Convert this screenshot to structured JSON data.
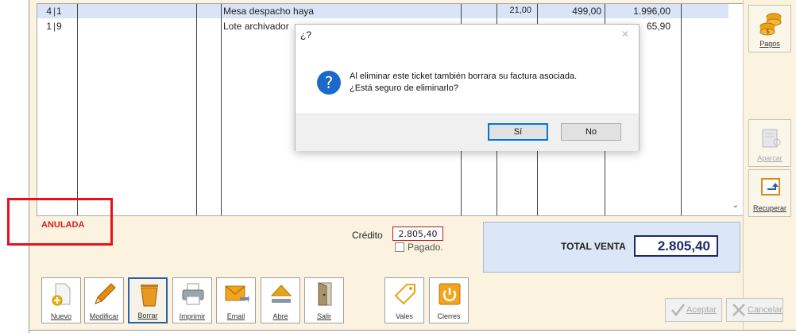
{
  "grid": {
    "rows": [
      {
        "qty": "4",
        "code": "1",
        "description": "Mesa despacho haya",
        "discount": "21,00",
        "price": "499,00",
        "total": "1.996,00"
      },
      {
        "qty": "1",
        "code": "9",
        "description": "Lote archivador",
        "discount": "",
        "price": "",
        "total": "65,90"
      }
    ]
  },
  "status": {
    "anulada": "ANULADA"
  },
  "credito": {
    "label": "Crédito",
    "value": "2.805,40",
    "pagado_label": "Pagado."
  },
  "total": {
    "label": "TOTAL VENTA",
    "value": "2.805,40"
  },
  "toolbar": {
    "nuevo": "Nuevo",
    "modificar": "Modificar",
    "borrar": "Borrar",
    "imprimir": "Imprimir",
    "email": "Email",
    "abre": "Abre",
    "salir": "Salir",
    "vales": "Vales",
    "cierres": "Cierres"
  },
  "right_panel": {
    "pagos": "Pagos",
    "aparcar": "Aparcar",
    "recuperar": "Recuperar"
  },
  "actions": {
    "aceptar": "Aceptar",
    "cancelar": "Cancelar"
  },
  "dialog": {
    "title": "¿?",
    "message_line1": "Al eliminar este ticket también borrara su factura asociada.",
    "message_line2": "¿Está seguro de eliminarlo?",
    "yes": "Sí",
    "no": "No"
  },
  "colors": {
    "accent_red": "#e8101a",
    "panel_bg": "#fbf3e0",
    "total_panel": "#dbe6f6",
    "dialog_focus": "#0078d7"
  }
}
